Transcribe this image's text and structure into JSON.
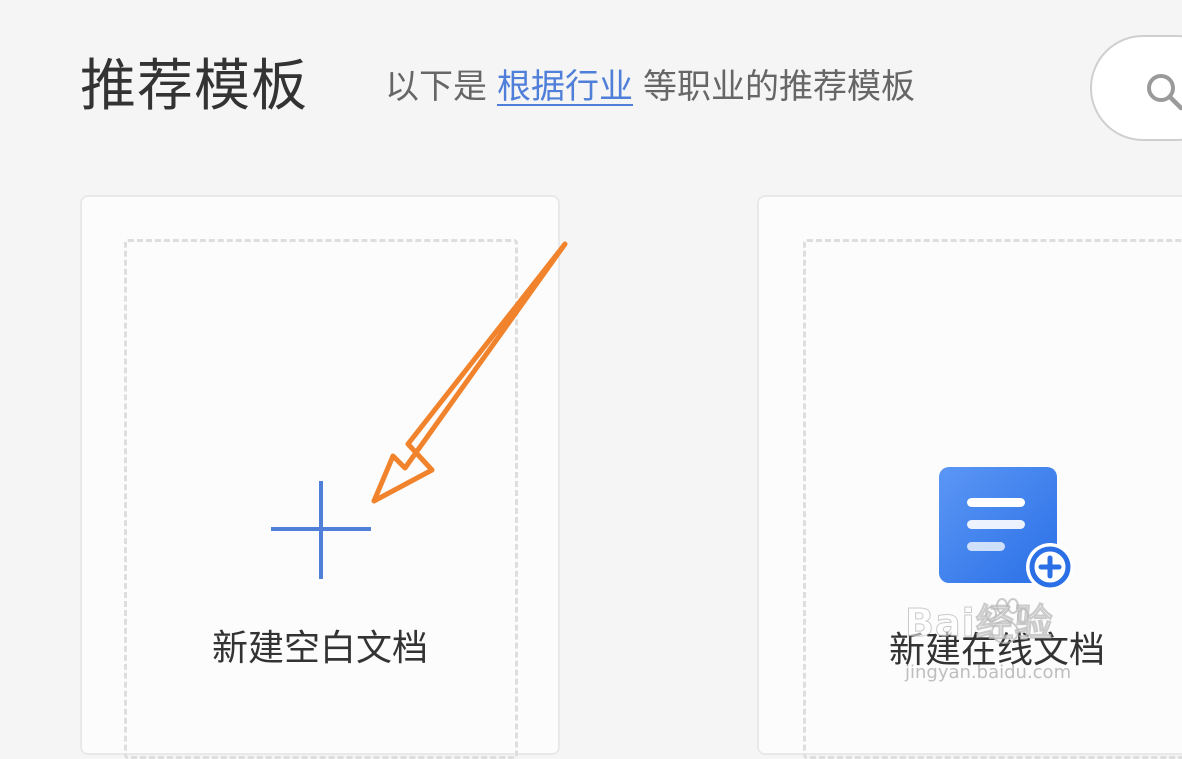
{
  "header": {
    "title": "推荐模板",
    "subtitle_prefix": "以下是",
    "industry_link": "根据行业",
    "subtitle_suffix": "等职业的推荐模板"
  },
  "search": {
    "icon": "search-icon"
  },
  "cards": [
    {
      "label": "新建空白文档",
      "icon": "plus-icon",
      "icon_color": "#4f7fd9"
    },
    {
      "label": "新建在线文档",
      "icon": "doc-plus-icon",
      "icon_color": "#3a7df0"
    }
  ],
  "annotation": {
    "arrow_color": "#f0832c"
  },
  "watermark": {
    "brand": "Bai经验",
    "url": "jingyan.baidu.com"
  }
}
